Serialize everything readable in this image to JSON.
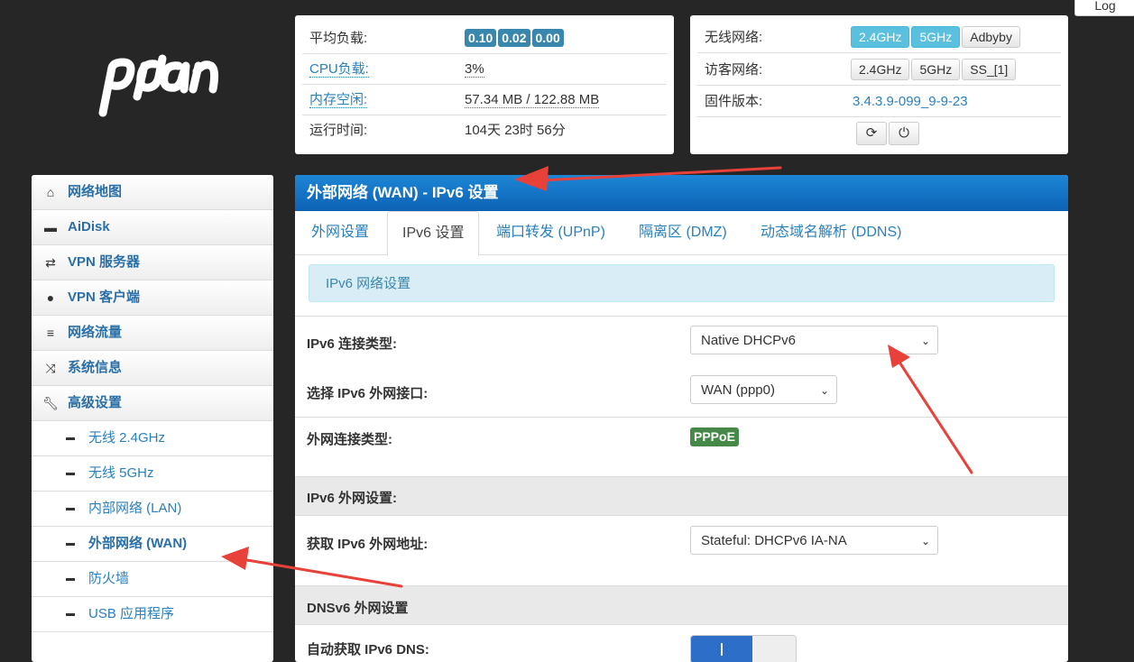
{
  "top": {
    "logout_label": "Log"
  },
  "brand": {
    "logo_text": "pdcn"
  },
  "status": {
    "load_label": "平均负载:",
    "load_values": [
      "0.10",
      "0.02",
      "0.00"
    ],
    "cpu_label": "CPU负载:",
    "cpu_value": "3%",
    "mem_label": "内存空闲:",
    "mem_value": "57.34 MB / 122.88 MB",
    "uptime_label": "运行时间:",
    "uptime_value": "104天 23时 56分"
  },
  "network": {
    "wireless_label": "无线网络:",
    "wireless_buttons": [
      "2.4GHz",
      "5GHz",
      "Adbyby"
    ],
    "guest_label": "访客网络:",
    "guest_buttons": [
      "2.4GHz",
      "5GHz",
      "SS_[1]"
    ],
    "firmware_label": "固件版本:",
    "firmware_value": "3.4.3.9-099_9-9-23"
  },
  "sidebar": {
    "items": [
      {
        "label": "网络地图",
        "icon": "home-icon"
      },
      {
        "label": "AiDisk",
        "icon": "hdd-icon"
      },
      {
        "label": "VPN 服务器",
        "icon": "retweet-icon"
      },
      {
        "label": "VPN 客户端",
        "icon": "globe-icon"
      },
      {
        "label": "网络流量",
        "icon": "list-icon"
      },
      {
        "label": "系统信息",
        "icon": "random-icon"
      },
      {
        "label": "高级设置",
        "icon": "wrench-icon"
      }
    ],
    "subitems": [
      "无线 2.4GHz",
      "无线 5GHz",
      "内部网络 (LAN)",
      "外部网络 (WAN)",
      "防火墙",
      "USB 应用程序"
    ]
  },
  "main": {
    "title": "外部网络 (WAN) - IPv6 设置",
    "tabs": [
      "外网设置",
      "IPv6 设置",
      "端口转发 (UPnP)",
      "隔离区 (DMZ)",
      "动态域名解析 (DDNS)"
    ],
    "info_text": "IPv6 网络设置",
    "conn_type_label": "IPv6 连接类型:",
    "conn_type_value": "Native DHCPv6",
    "wan_iface_label": "选择 IPv6 外网接口:",
    "wan_iface_value": "WAN (ppp0)",
    "wan_conn_label": "外网连接类型:",
    "wan_conn_value": "PPPoE",
    "section_wan": "IPv6 外网设置:",
    "get_addr_label": "获取 IPv6 外网地址:",
    "get_addr_value": "Stateful: DHCPv6 IA-NA",
    "section_dns": "DNSv6 外网设置",
    "auto_dns_label": "自动获取 IPv6 DNS:"
  },
  "colors": {
    "accent": "#0d62b5",
    "arrow": "#e8413a",
    "badge": "#3a87ad",
    "pppoe": "#468847"
  }
}
